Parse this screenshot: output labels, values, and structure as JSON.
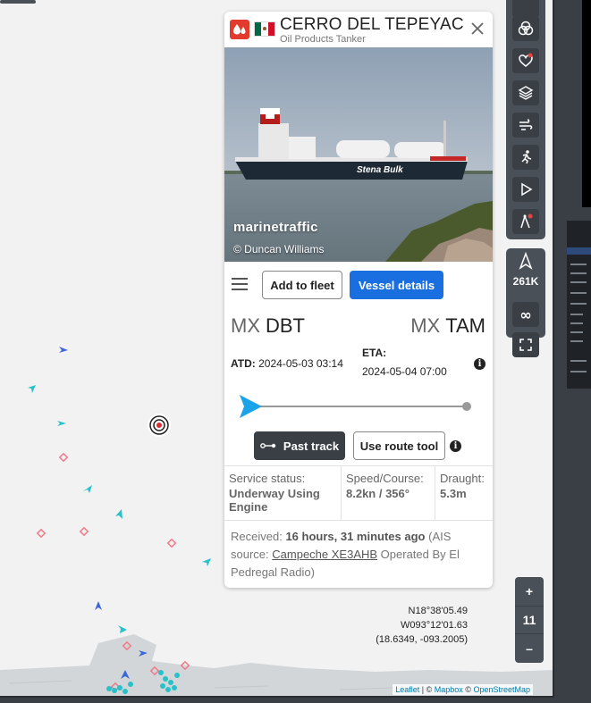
{
  "vessel": {
    "name": "CERRO DEL TEPEYAC",
    "type": "Oil Products Tanker"
  },
  "photo": {
    "watermark": "marinetraffic",
    "credit": "© Duncan Williams"
  },
  "actions": {
    "add_fleet": "Add to fleet",
    "vessel_details": "Vessel details"
  },
  "route": {
    "from_cc": "MX",
    "from_port": "DBT",
    "to_cc": "MX",
    "to_port": "TAM",
    "atd_label": "ATD:",
    "atd_value": "2024-05-03 03:14",
    "eta_label": "ETA:",
    "eta_value": "2024-05-04 07:00",
    "progress": 0
  },
  "buttons": {
    "past_track": "Past track",
    "route_tool": "Use route tool"
  },
  "stats": {
    "service_label": "Service status:",
    "service_value": "Underway Using Engine",
    "speed_label": "Speed/Course:",
    "speed_value": "8.2kn / 356°",
    "draught_label": "Draught:",
    "draught_value": "5.3m"
  },
  "received": {
    "prefix": "Received:",
    "age": "16 hours, 31 minutes ago",
    "mid": "(AIS source:",
    "source": "Campeche XE3AHB",
    "suffix": "Operated By El Pedregal Radio)"
  },
  "map": {
    "lat": "N18°38'05.49",
    "lon": "W093°12'01.63",
    "decimal": "(18.6349, -093.2005)",
    "zoom_in": "+",
    "zoom_level": "11",
    "zoom_out": "–",
    "count": "261K",
    "attr_leaflet": "Leaflet",
    "attr_sep1": " | © ",
    "attr_mapbox": "Mapbox",
    "attr_sep2": " © ",
    "attr_osm": "OpenStreetMap"
  },
  "colors": {
    "primary": "#1a6fe0",
    "toolbar": "#4a5058",
    "dark": "#3a3f46",
    "progress": "#1aa3e8"
  }
}
